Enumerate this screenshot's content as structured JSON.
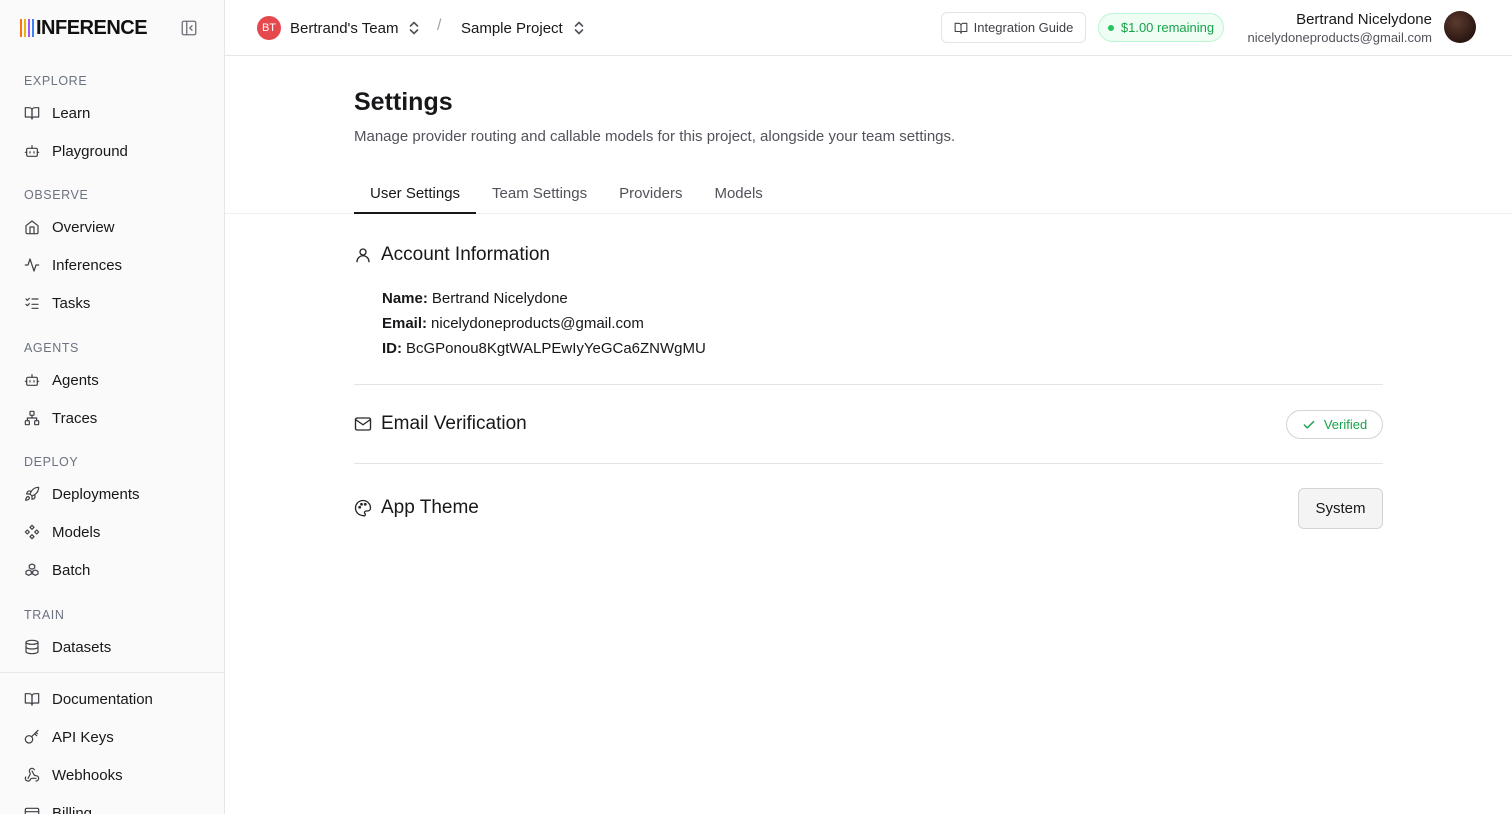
{
  "brand": {
    "name": "INFERENCE",
    "bar_colors": [
      "#f97316",
      "#eab308",
      "#a855f7",
      "#3b82f6"
    ]
  },
  "sidebar": {
    "sections": [
      {
        "title": "EXPLORE",
        "items": [
          {
            "label": "Learn",
            "icon": "book-icon"
          },
          {
            "label": "Playground",
            "icon": "bot-icon"
          }
        ]
      },
      {
        "title": "OBSERVE",
        "items": [
          {
            "label": "Overview",
            "icon": "home-icon"
          },
          {
            "label": "Inferences",
            "icon": "activity-icon"
          },
          {
            "label": "Tasks",
            "icon": "list-checks-icon"
          }
        ]
      },
      {
        "title": "AGENTS",
        "items": [
          {
            "label": "Agents",
            "icon": "bot-icon"
          },
          {
            "label": "Traces",
            "icon": "network-icon"
          }
        ]
      },
      {
        "title": "DEPLOY",
        "items": [
          {
            "label": "Deployments",
            "icon": "rocket-icon"
          },
          {
            "label": "Models",
            "icon": "diamonds-icon"
          },
          {
            "label": "Batch",
            "icon": "boxes-icon"
          }
        ]
      },
      {
        "title": "TRAIN",
        "items": [
          {
            "label": "Datasets",
            "icon": "database-icon"
          }
        ]
      }
    ],
    "footer_items": [
      {
        "label": "Documentation",
        "icon": "book-icon"
      },
      {
        "label": "API Keys",
        "icon": "key-icon"
      },
      {
        "label": "Webhooks",
        "icon": "webhook-icon"
      },
      {
        "label": "Billing",
        "icon": "credit-card-icon"
      }
    ]
  },
  "topbar": {
    "team_initials": "BT",
    "team_name": "Bertrand's Team",
    "separator": "/",
    "project_name": "Sample Project",
    "integration_guide": "Integration Guide",
    "credits": "$1.00 remaining",
    "user_name": "Bertrand Nicelydone",
    "user_email": "nicelydoneproducts@gmail.com"
  },
  "page": {
    "title": "Settings",
    "subtitle": "Manage provider routing and callable models for this project, alongside your team settings.",
    "tabs": [
      "User Settings",
      "Team Settings",
      "Providers",
      "Models"
    ],
    "active_tab": "User Settings"
  },
  "account": {
    "title": "Account Information",
    "name_label": "Name:",
    "name": "Bertrand Nicelydone",
    "email_label": "Email:",
    "email": "nicelydoneproducts@gmail.com",
    "id_label": "ID:",
    "id": "BcGPonou8KgtWALPEwIyYeGCa6ZNWgMU"
  },
  "email_verification": {
    "title": "Email Verification",
    "status": "Verified"
  },
  "app_theme": {
    "title": "App Theme",
    "value": "System"
  }
}
